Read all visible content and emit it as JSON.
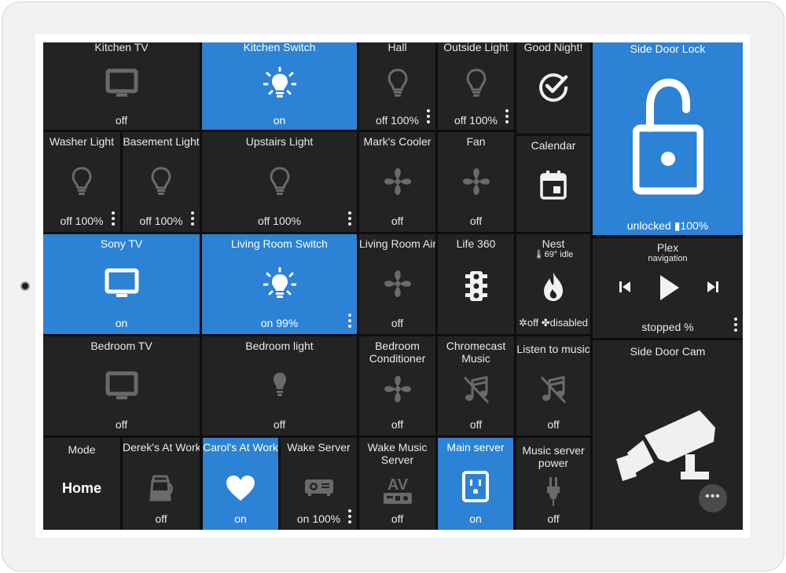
{
  "dashboard": {
    "tiles": {
      "kitchen_tv": {
        "title": "Kitchen TV",
        "state": "off",
        "icon": "tv-icon"
      },
      "kitchen_switch": {
        "title": "Kitchen Switch",
        "state": "on",
        "icon": "light-bulb-icon"
      },
      "hall": {
        "title": "Hall",
        "state": "off 100%",
        "icon": "light-bulb-icon"
      },
      "outside_light": {
        "title": "Outside Light",
        "state": "off 100%",
        "icon": "light-bulb-icon"
      },
      "good_night": {
        "title": "Good Night!",
        "icon": "check-circle-icon"
      },
      "side_door_lock": {
        "title": "Side Door Lock",
        "state": "unlocked",
        "battery": "100%",
        "icon": "open-padlock-icon"
      },
      "washer_light": {
        "title": "Washer Light",
        "state": "off 100%",
        "icon": "light-bulb-icon"
      },
      "basement_light": {
        "title": "Basement Light",
        "state": "off 100%",
        "icon": "light-bulb-icon"
      },
      "upstairs_light": {
        "title": "Upstairs Light",
        "state": "off 100%",
        "icon": "light-bulb-icon"
      },
      "marks_cooler": {
        "title": "Mark's Cooler",
        "state": "off",
        "icon": "fan-icon"
      },
      "fan": {
        "title": "Fan",
        "state": "off",
        "icon": "fan-icon"
      },
      "calendar": {
        "title": "Calendar",
        "icon": "calendar-icon"
      },
      "sony_tv": {
        "title": "Sony TV",
        "state": "on",
        "icon": "tv-icon"
      },
      "living_room_switch": {
        "title": "Living Room Switch",
        "state": "on 99%",
        "icon": "light-bulb-icon"
      },
      "living_room_air": {
        "title": "Living Room Air",
        "state": "off",
        "icon": "fan-icon"
      },
      "life360": {
        "title": "Life 360",
        "icon": "traffic-light-icon"
      },
      "nest": {
        "title": "Nest",
        "subtitle": "🌡69° idle",
        "state_off": "off",
        "state_fan": "disabled",
        "icon": "flame-icon"
      },
      "plex": {
        "title": "Plex",
        "subtitle": "navigation",
        "state": "stopped %",
        "icon": "media-controls-icon"
      },
      "bedroom_tv": {
        "title": "Bedroom TV",
        "state": "off",
        "icon": "tv-icon"
      },
      "bedroom_light": {
        "title": "Bedroom light",
        "state": "off",
        "icon": "light-bulb-icon"
      },
      "bedroom_conditioner": {
        "title": "Bedroom Conditioner",
        "state": "off",
        "icon": "fan-icon"
      },
      "chromecast_music": {
        "title": "Chromecast Music",
        "state": "off",
        "icon": "music-off-icon"
      },
      "listen_to_music": {
        "title": "Listen to music",
        "state": "off",
        "icon": "music-off-icon"
      },
      "side_door_cam": {
        "title": "Side Door Cam",
        "icon": "security-camera-icon",
        "more": "•••"
      },
      "mode": {
        "title": "Mode",
        "value": "Home"
      },
      "dereks_at_work": {
        "title": "Derek's At Work",
        "state": "off",
        "icon": "coffee-pot-icon"
      },
      "carols_at_work": {
        "title": "Carol's At Work",
        "state": "on",
        "icon": "heart-icon"
      },
      "wake_server": {
        "title": "Wake Server",
        "state": "on 100%",
        "icon": "projector-icon"
      },
      "wake_music_server": {
        "title": "Wake Music Server",
        "state": "off",
        "icon": "av-receiver-icon"
      },
      "main_server": {
        "title": "Main server",
        "state": "on",
        "icon": "power-outlet-icon"
      },
      "music_server_power": {
        "title": "Music server power",
        "state": "off",
        "icon": "power-plug-icon"
      }
    }
  },
  "colors": {
    "tile_off": "#232323",
    "tile_on": "#2c82d4",
    "background": "#0e0e0e",
    "bezel": "#f1f1f1"
  }
}
